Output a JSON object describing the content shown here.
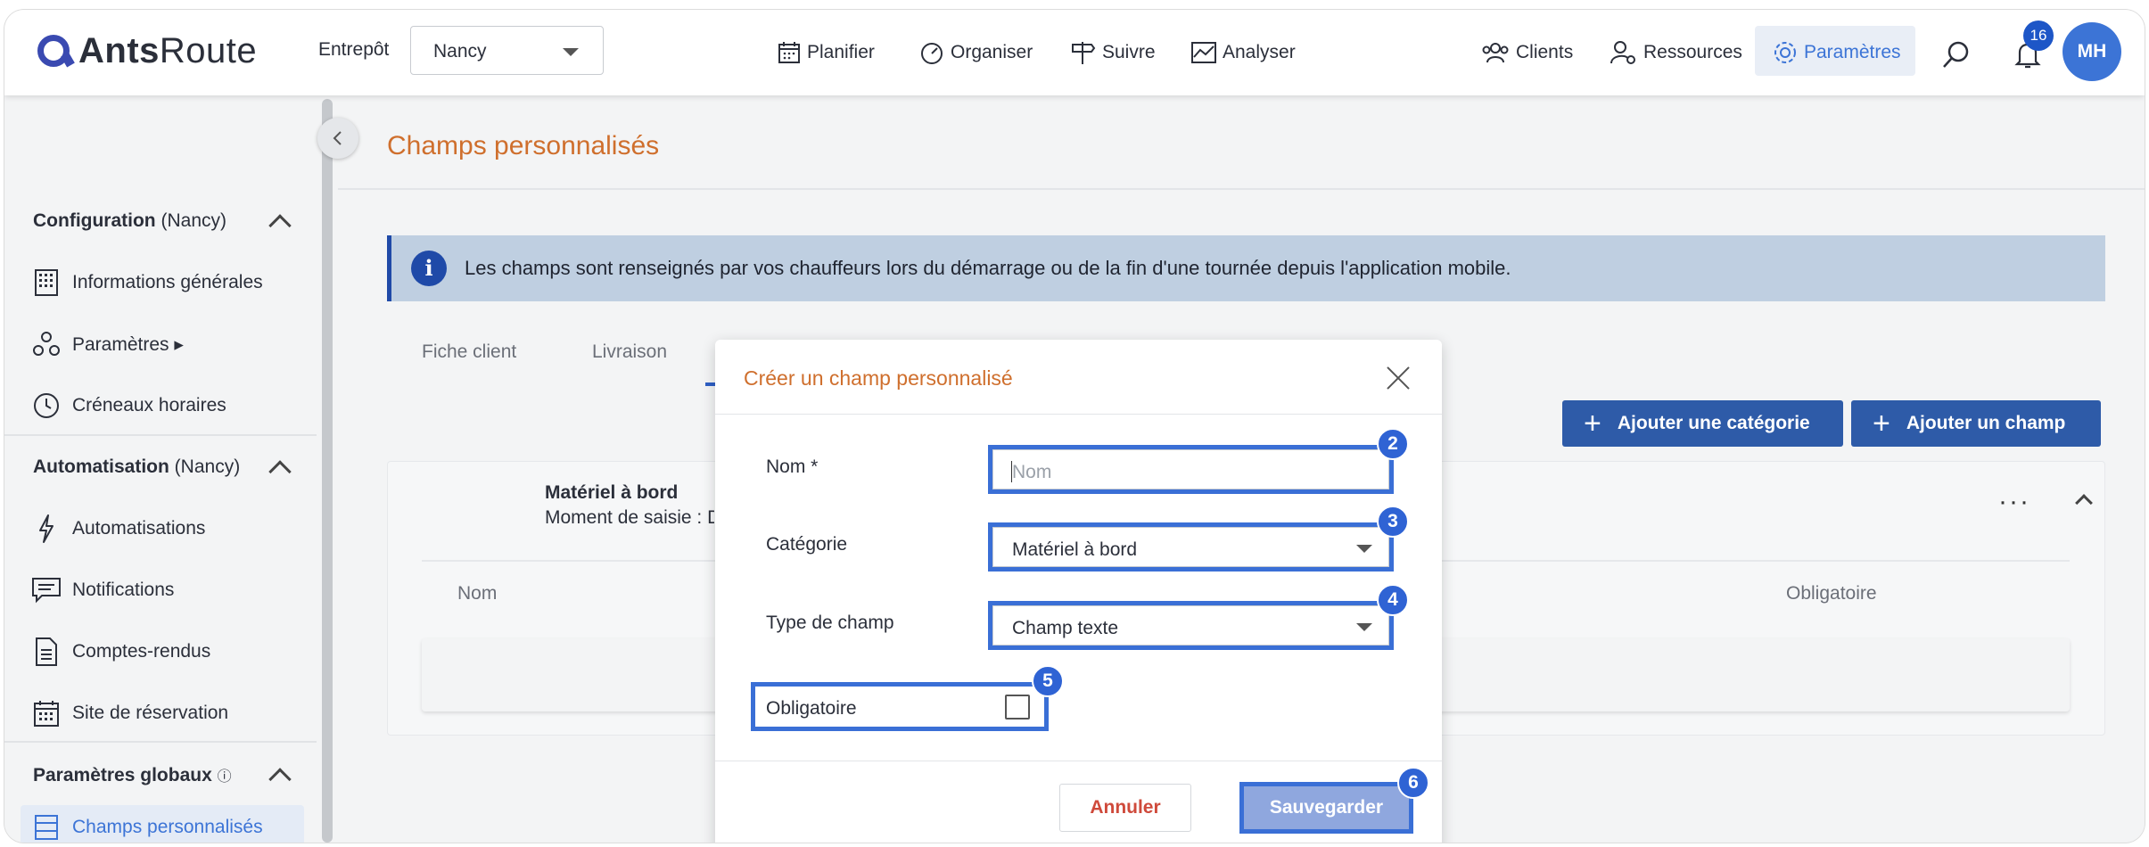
{
  "topbar": {
    "logo": {
      "brand_bold": "Ants",
      "brand_light": "Route"
    },
    "entrepot_label": "Entrepôt",
    "entrepot_value": "Nancy",
    "nav": [
      {
        "label": "Planifier",
        "icon": "calendar-icon"
      },
      {
        "label": "Organiser",
        "icon": "speedometer-icon"
      },
      {
        "label": "Suivre",
        "icon": "signpost-icon"
      },
      {
        "label": "Analyser",
        "icon": "chart-icon"
      }
    ],
    "right_nav": [
      {
        "label": "Clients",
        "icon": "users-icon"
      },
      {
        "label": "Ressources",
        "icon": "user-gear-icon"
      },
      {
        "label": "Paramètres",
        "icon": "gear-icon",
        "active": true
      }
    ],
    "notifications_count": "16",
    "avatar_initials": "MH",
    "accent_color": "#3c74d6"
  },
  "sidebar": {
    "sections": [
      {
        "title_bold": "Configuration",
        "title_rest": " (Nancy)"
      },
      {
        "title_bold": "Automatisation",
        "title_rest": " (Nancy)"
      },
      {
        "title_bold": "Paramètres globaux",
        "title_rest": ""
      }
    ],
    "items": [
      {
        "label": "Informations générales",
        "icon": "building-icon"
      },
      {
        "label": "Paramètres ▸",
        "icon": "nodes-icon"
      },
      {
        "label": "Créneaux horaires",
        "icon": "clock-icon"
      },
      {
        "label": "Automatisations",
        "icon": "bolt-icon"
      },
      {
        "label": "Notifications",
        "icon": "message-icon"
      },
      {
        "label": "Comptes-rendus",
        "icon": "document-icon"
      },
      {
        "label": "Site de réservation",
        "icon": "calendar-icon"
      },
      {
        "label": "Champs personnalisés",
        "icon": "table-icon",
        "active": true
      }
    ]
  },
  "main": {
    "page_title": "Champs personnalisés",
    "info_text": "Les champs sont renseignés par vos chauffeurs lors du démarrage ou de la fin d'une tournée depuis l'application mobile.",
    "tabs": [
      "Fiche client",
      "Livraison"
    ],
    "buttons": {
      "add_category": "Ajouter une catégorie",
      "add_field": "Ajouter un champ"
    },
    "card": {
      "title": "Matériel à bord",
      "subtitle": "Moment de saisie : D",
      "columns": [
        "Nom",
        "Obligatoire"
      ]
    }
  },
  "modal": {
    "title": "Créer un champ personnalisé",
    "fields": {
      "nom_label": "Nom *",
      "nom_placeholder": "Nom",
      "categorie_label": "Catégorie",
      "categorie_value": "Matériel à bord",
      "type_label": "Type de champ",
      "type_value": "Champ texte",
      "obligatoire_label": "Obligatoire",
      "obligatoire_checked": false
    },
    "buttons": {
      "cancel": "Annuler",
      "save": "Sauvegarder"
    },
    "badges": [
      "2",
      "3",
      "4",
      "5",
      "6"
    ],
    "highlight_color": "#3a6fd6"
  }
}
